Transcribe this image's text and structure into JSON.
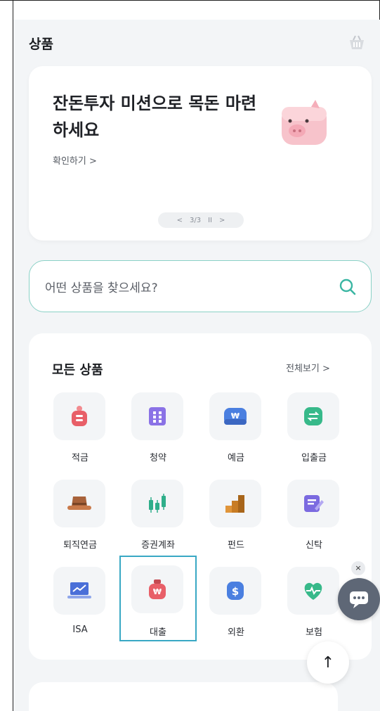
{
  "header": {
    "title": "상품",
    "basket_icon": "basket-icon"
  },
  "banner": {
    "title": "잔돈투자 미션으로 목돈 마련하세요",
    "link": "확인하기 >",
    "image_icon": "piggy-bank-icon",
    "pager": {
      "prev": "<",
      "position": "3/3",
      "pause": "II",
      "next": ">"
    }
  },
  "search": {
    "placeholder": "어떤 상품을 찾으세요?",
    "icon": "search-icon"
  },
  "products": {
    "title": "모든 상품",
    "see_all": "전체보기 >",
    "items": [
      {
        "label": "적금",
        "icon": "savings-bag-icon"
      },
      {
        "label": "청약",
        "icon": "subscription-grid-icon"
      },
      {
        "label": "예금",
        "icon": "deposit-won-icon"
      },
      {
        "label": "입출금",
        "icon": "transfer-icon"
      },
      {
        "label": "퇴직연금",
        "icon": "hat-icon"
      },
      {
        "label": "증권계좌",
        "icon": "candlestick-icon"
      },
      {
        "label": "펀드",
        "icon": "stairs-icon"
      },
      {
        "label": "신탁",
        "icon": "document-pen-icon"
      },
      {
        "label": "ISA",
        "icon": "laptop-chart-icon"
      },
      {
        "label": "대출",
        "icon": "loan-bag-icon",
        "selected": true
      },
      {
        "label": "외환",
        "icon": "dollar-icon"
      },
      {
        "label": "보험",
        "icon": "heart-pulse-icon"
      }
    ]
  },
  "floating": {
    "chat_icon": "chat-icon",
    "close": "×",
    "top": "↑"
  },
  "colors": {
    "accent": "#39a8c4",
    "search_border": "#8ad1c6",
    "background": "#f3f5f7"
  }
}
